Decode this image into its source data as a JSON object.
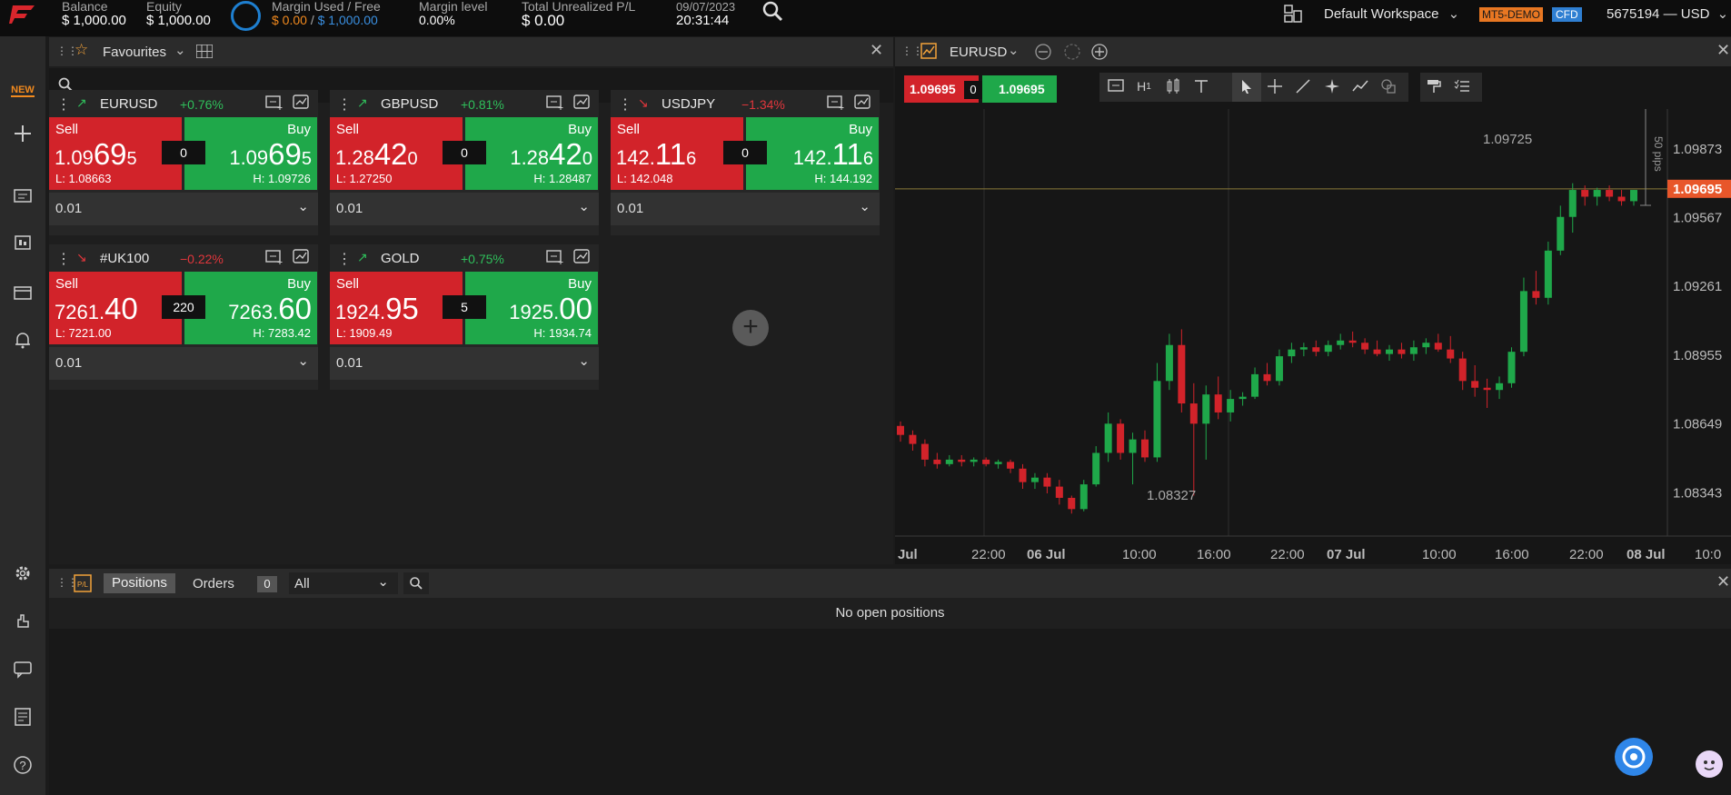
{
  "account": {
    "balance_label": "Balance",
    "balance": "$ 1,000.00",
    "equity_label": "Equity",
    "equity": "$ 1,000.00",
    "margin_label": "Margin Used / Free",
    "margin_used": "$ 0.00",
    "margin_sep": " / ",
    "margin_free": "$ 1,000.00",
    "margin_level_label": "Margin level",
    "margin_level": "0.00%",
    "unrealized_label": "Total Unrealized P/L",
    "unrealized": "$ 0.00",
    "date": "09/07/2023",
    "time": "20:31:44"
  },
  "header_right": {
    "workspace": "Default Workspace",
    "badge_demo": "MT5-DEMO",
    "badge_cfd": "CFD",
    "account_id": "5675194 — USD"
  },
  "sidebar": {
    "new_label": "NEW"
  },
  "favourites": {
    "title": "Favourites",
    "tiles": [
      {
        "symbol": "EURUSD",
        "change": "+0.76%",
        "change_dir": "up",
        "sell_label": "Sell",
        "buy_label": "Buy",
        "sell_a": "1.09",
        "sell_b": "69",
        "sell_c": "5",
        "buy_a": "1.09",
        "buy_b": "69",
        "buy_c": "5",
        "spread": "0",
        "low": "L: 1.08663",
        "high": "H: 1.09726",
        "lot": "0.01"
      },
      {
        "symbol": "GBPUSD",
        "change": "+0.81%",
        "change_dir": "up",
        "sell_label": "Sell",
        "buy_label": "Buy",
        "sell_a": "1.28",
        "sell_b": "42",
        "sell_c": "0",
        "buy_a": "1.28",
        "buy_b": "42",
        "buy_c": "0",
        "spread": "0",
        "low": "L: 1.27250",
        "high": "H: 1.28487",
        "lot": "0.01"
      },
      {
        "symbol": "USDJPY",
        "change": "−1.34%",
        "change_dir": "down",
        "sell_label": "Sell",
        "buy_label": "Buy",
        "sell_a": "142.",
        "sell_b": "11",
        "sell_c": "6",
        "buy_a": "142.",
        "buy_b": "11",
        "buy_c": "6",
        "spread": "0",
        "low": "L: 142.048",
        "high": "H: 144.192",
        "lot": "0.01"
      },
      {
        "symbol": "#UK100",
        "change": "−0.22%",
        "change_dir": "down",
        "sell_label": "Sell",
        "buy_label": "Buy",
        "sell_a": "7261.",
        "sell_b": "40",
        "sell_c": "",
        "buy_a": "7263.",
        "buy_b": "60",
        "buy_c": "",
        "spread": "220",
        "low": "L: 7221.00",
        "high": "H: 7283.42",
        "lot": "0.01"
      },
      {
        "symbol": "GOLD",
        "change": "+0.75%",
        "change_dir": "up",
        "sell_label": "Sell",
        "buy_label": "Buy",
        "sell_a": "1924.",
        "sell_b": "95",
        "sell_c": "",
        "buy_a": "1925.",
        "buy_b": "00",
        "buy_c": "",
        "spread": "5",
        "low": "L: 1909.49",
        "high": "H: 1934.74",
        "lot": "0.01"
      }
    ]
  },
  "chart": {
    "symbol": "EURUSD",
    "sell_price": "1.09695",
    "buy_price": "1.09695",
    "spread": "0",
    "timeframe": "H",
    "timeframe_sub": "1",
    "pips_label": "50 pips",
    "current_price": "1.09695",
    "high_label": "1.09725",
    "low_label": "1.08327",
    "y_ticks": [
      "1.09873",
      "1.09567",
      "1.09261",
      "1.08955",
      "1.08649",
      "1.08343"
    ],
    "x_ticks": [
      "Jul",
      "22:00",
      "06 Jul",
      "10:00",
      "16:00",
      "22:00",
      "07 Jul",
      "10:00",
      "16:00",
      "22:00",
      "08 Jul",
      "10:0"
    ]
  },
  "chart_data": {
    "type": "candlestick",
    "title": "EURUSD",
    "ylim": [
      1.0815,
      1.1005
    ],
    "ohlc": [
      [
        1.0864,
        1.0866,
        1.0857,
        1.086
      ],
      [
        1.086,
        1.0862,
        1.0853,
        1.0856
      ],
      [
        1.0856,
        1.0858,
        1.0846,
        1.0849
      ],
      [
        1.0849,
        1.0852,
        1.0845,
        1.0847
      ],
      [
        1.0847,
        1.0851,
        1.0846,
        1.0849
      ],
      [
        1.0849,
        1.0851,
        1.0846,
        1.0848
      ],
      [
        1.0848,
        1.085,
        1.0846,
        1.0849
      ],
      [
        1.0849,
        1.085,
        1.0846,
        1.0847
      ],
      [
        1.0847,
        1.0849,
        1.0845,
        1.0848
      ],
      [
        1.0848,
        1.0849,
        1.0843,
        1.0845
      ],
      [
        1.0845,
        1.0847,
        1.0836,
        1.0839
      ],
      [
        1.0839,
        1.0843,
        1.0836,
        1.0841
      ],
      [
        1.0841,
        1.0843,
        1.0834,
        1.0837
      ],
      [
        1.0837,
        1.084,
        1.0829,
        1.0832
      ],
      [
        1.0832,
        1.0833,
        1.0825,
        1.0827
      ],
      [
        1.0827,
        1.084,
        1.0826,
        1.0838
      ],
      [
        1.0838,
        1.0855,
        1.0837,
        1.0852
      ],
      [
        1.0852,
        1.087,
        1.0848,
        1.0865
      ],
      [
        1.0865,
        1.0867,
        1.0849,
        1.0852
      ],
      [
        1.0852,
        1.0861,
        1.0838,
        1.0858
      ],
      [
        1.0858,
        1.0862,
        1.0848,
        1.085
      ],
      [
        1.085,
        1.0892,
        1.0848,
        1.0884
      ],
      [
        1.0884,
        1.0905,
        1.088,
        1.09
      ],
      [
        1.09,
        1.0907,
        1.087,
        1.0874
      ],
      [
        1.0874,
        1.0883,
        1.0833,
        1.0865
      ],
      [
        1.0865,
        1.0882,
        1.0849,
        1.0878
      ],
      [
        1.0878,
        1.0886,
        1.0867,
        1.087
      ],
      [
        1.087,
        1.088,
        1.0866,
        1.0876
      ],
      [
        1.0876,
        1.0879,
        1.0873,
        1.0877
      ],
      [
        1.0877,
        1.089,
        1.0876,
        1.0887
      ],
      [
        1.0887,
        1.0892,
        1.0882,
        1.0884
      ],
      [
        1.0884,
        1.0898,
        1.0882,
        1.0895
      ],
      [
        1.0895,
        1.0901,
        1.0892,
        1.0898
      ],
      [
        1.0898,
        1.0901,
        1.0895,
        1.0899
      ],
      [
        1.0899,
        1.0902,
        1.0895,
        1.0897
      ],
      [
        1.0897,
        1.0902,
        1.0895,
        1.09
      ],
      [
        1.09,
        1.0905,
        1.0898,
        1.0902
      ],
      [
        1.0902,
        1.0906,
        1.0899,
        1.0901
      ],
      [
        1.0901,
        1.0903,
        1.0896,
        1.0898
      ],
      [
        1.0898,
        1.0902,
        1.0895,
        1.0896
      ],
      [
        1.0896,
        1.09,
        1.0893,
        1.0898
      ],
      [
        1.0898,
        1.0901,
        1.0894,
        1.0896
      ],
      [
        1.0896,
        1.0902,
        1.0893,
        1.0899
      ],
      [
        1.0899,
        1.0903,
        1.0896,
        1.0901
      ],
      [
        1.0901,
        1.0905,
        1.0897,
        1.0898
      ],
      [
        1.0898,
        1.0904,
        1.0892,
        1.0894
      ],
      [
        1.0894,
        1.0897,
        1.088,
        1.0884
      ],
      [
        1.0884,
        1.0891,
        1.0877,
        1.0881
      ],
      [
        1.0881,
        1.0885,
        1.0872,
        1.088
      ],
      [
        1.088,
        1.0886,
        1.0876,
        1.0883
      ],
      [
        1.0883,
        1.0899,
        1.0881,
        1.0897
      ],
      [
        1.0897,
        1.093,
        1.0895,
        1.0924
      ],
      [
        1.0924,
        1.0933,
        1.0918,
        1.0921
      ],
      [
        1.0921,
        1.0946,
        1.0918,
        1.0942
      ],
      [
        1.0942,
        1.0962,
        1.094,
        1.0957
      ],
      [
        1.0957,
        1.0972,
        1.095,
        1.0969
      ],
      [
        1.0969,
        1.0971,
        1.0962,
        1.0966
      ],
      [
        1.0966,
        1.097,
        1.0962,
        1.0969
      ],
      [
        1.0969,
        1.0971,
        1.0964,
        1.0966
      ],
      [
        1.0966,
        1.0969,
        1.0962,
        1.0964
      ],
      [
        1.0964,
        1.0969,
        1.0962,
        1.0969
      ]
    ]
  },
  "positions": {
    "tab_positions": "Positions",
    "tab_orders": "Orders",
    "orders_count": "0",
    "filter": "All",
    "empty_message": "No open positions"
  },
  "colors": {
    "sell": "#d2232a",
    "buy": "#1fa84a",
    "up_text": "#2fbf5b",
    "down_text": "#e0363c",
    "accent": "#e8562a",
    "badge_demo": "#e87722",
    "badge_cfd": "#2f7fd2"
  }
}
